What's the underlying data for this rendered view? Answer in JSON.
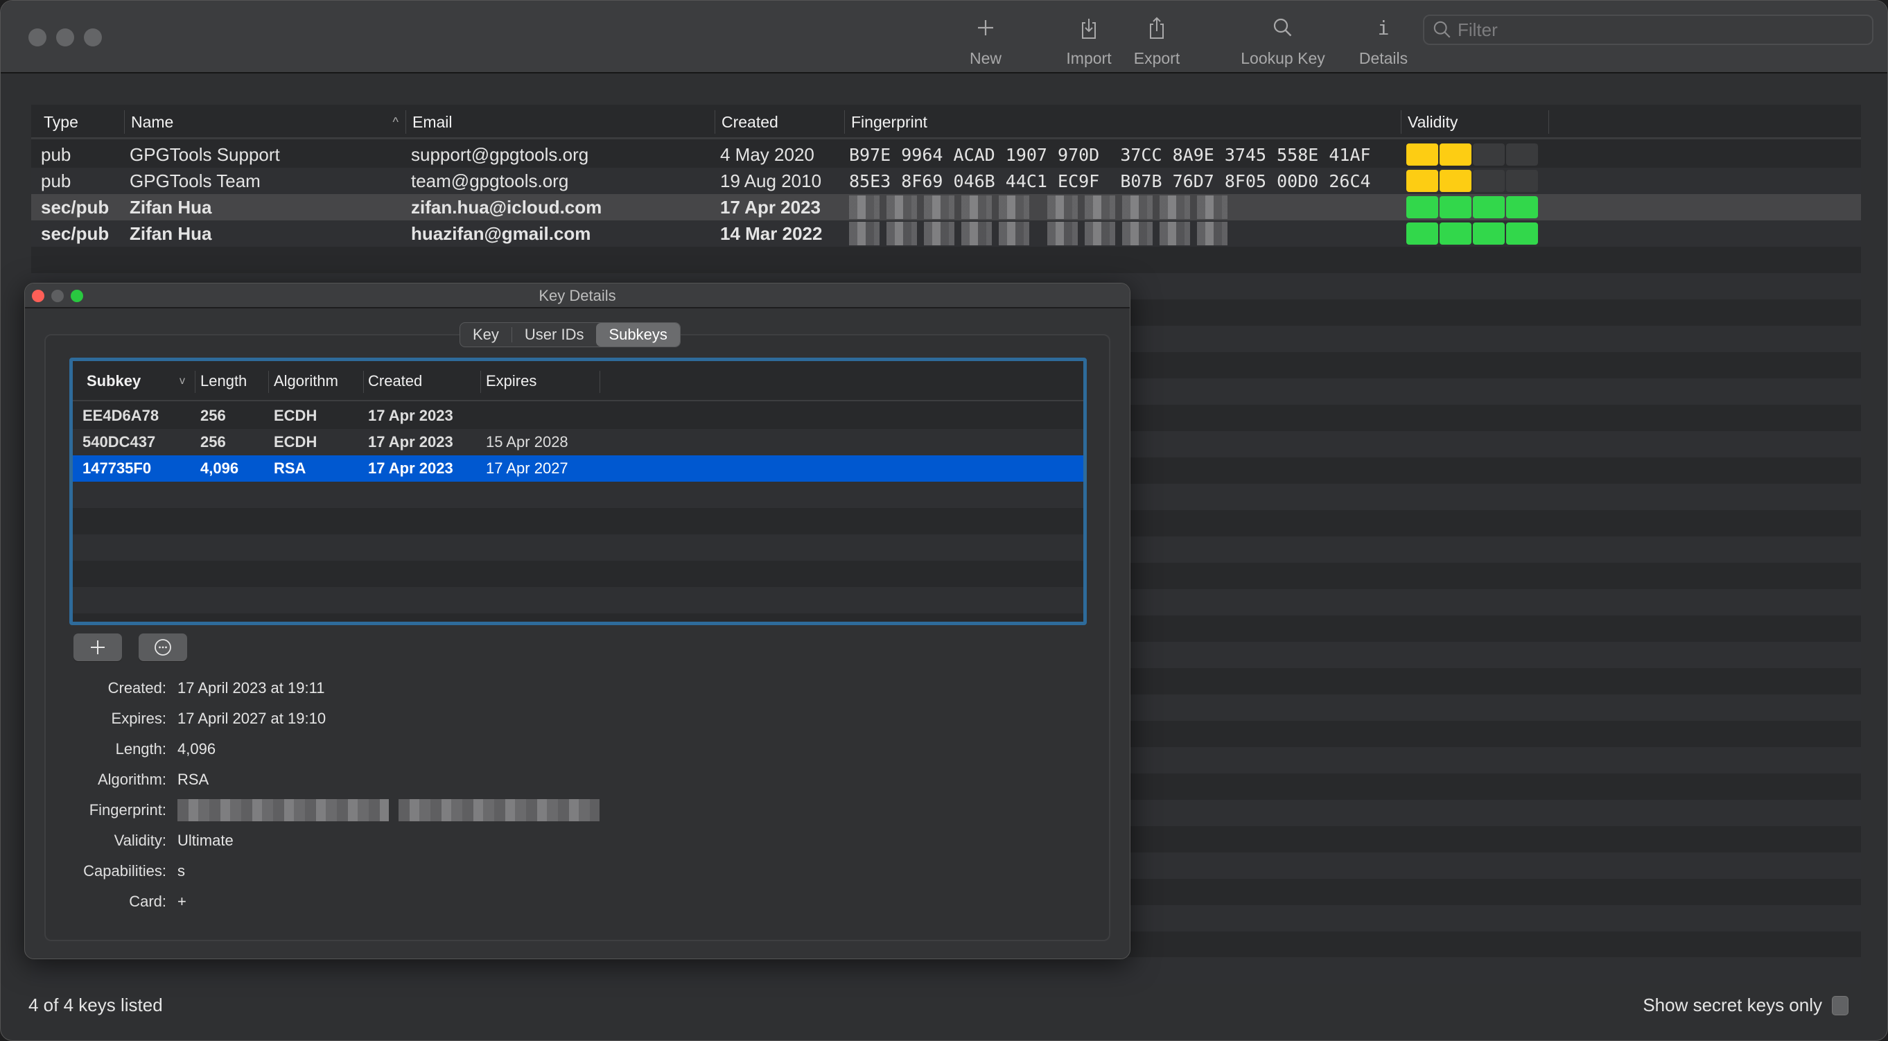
{
  "toolbar": {
    "buttons": [
      {
        "label": "New",
        "icon": "plus-icon"
      },
      {
        "label": "Import",
        "icon": "import-icon"
      },
      {
        "label": "Export",
        "icon": "export-icon"
      },
      {
        "label": "Lookup Key",
        "icon": "magnifier-icon"
      },
      {
        "label": "Details",
        "icon": "info-icon"
      }
    ],
    "filter_placeholder": "Filter",
    "filter_value": ""
  },
  "keys_table": {
    "columns": [
      "Type",
      "Name",
      "Email",
      "Created",
      "Fingerprint",
      "Validity"
    ],
    "sort_column": "Name",
    "sort_direction": "ascending",
    "rows": [
      {
        "type": "pub",
        "name": "GPGTools Support",
        "email": "support@gpgtools.org",
        "created": "4 May 2020",
        "fingerprint": "B97E 9964 ACAD 1907 970D  37CC 8A9E 3745 558E 41AF",
        "fingerprint_redacted": false,
        "validity_level": 2,
        "validity_max": 4,
        "validity_color": "#fdcd13",
        "bold": false,
        "selected": false
      },
      {
        "type": "pub",
        "name": "GPGTools Team",
        "email": "team@gpgtools.org",
        "created": "19 Aug 2010",
        "fingerprint": "85E3 8F69 046B 44C1 EC9F  B07B 76D7 8F05 00D0 26C4",
        "fingerprint_redacted": false,
        "validity_level": 2,
        "validity_max": 4,
        "validity_color": "#fdcd13",
        "bold": false,
        "selected": false
      },
      {
        "type": "sec/pub",
        "name": "Zifan Hua",
        "email": "zifan.hua@icloud.com",
        "created": "17 Apr 2023",
        "fingerprint": "",
        "fingerprint_redacted": true,
        "validity_level": 4,
        "validity_max": 4,
        "validity_color": "#32d74b",
        "bold": true,
        "selected": true
      },
      {
        "type": "sec/pub",
        "name": "Zifan Hua",
        "email": "huazifan@gmail.com",
        "created": "14 Mar 2022",
        "fingerprint": "",
        "fingerprint_redacted": true,
        "validity_level": 4,
        "validity_max": 4,
        "validity_color": "#32d74b",
        "bold": true,
        "selected": false
      }
    ]
  },
  "status": {
    "count_text": "4 of 4 keys listed",
    "secret_only_label": "Show secret keys only",
    "secret_only_checked": false
  },
  "key_details": {
    "title": "Key Details",
    "tabs": [
      {
        "label": "Key",
        "active": false
      },
      {
        "label": "User IDs",
        "active": false
      },
      {
        "label": "Subkeys",
        "active": true
      }
    ],
    "subkeys": {
      "columns": [
        "Subkey",
        "Length",
        "Algorithm",
        "Created",
        "Expires"
      ],
      "rows": [
        {
          "subkey": "EE4D6A78",
          "length": "256",
          "algorithm": "ECDH",
          "created": "17 Apr 2023",
          "expires": "",
          "selected": false
        },
        {
          "subkey": "540DC437",
          "length": "256",
          "algorithm": "ECDH",
          "created": "17 Apr 2023",
          "expires": "15 Apr 2028",
          "selected": false
        },
        {
          "subkey": "147735F0",
          "length": "4,096",
          "algorithm": "RSA",
          "created": "17 Apr 2023",
          "expires": "17 Apr 2027",
          "selected": true
        }
      ]
    },
    "add_button_icon": "plus-icon",
    "more_button_icon": "ellipsis-circle-icon",
    "fields": [
      {
        "label": "Created:",
        "value": "17 April 2023 at 19:11"
      },
      {
        "label": "Expires:",
        "value": "17 April 2027 at 19:10"
      },
      {
        "label": "Length:",
        "value": "4,096"
      },
      {
        "label": "Algorithm:",
        "value": "RSA"
      },
      {
        "label": "Fingerprint:",
        "value": "",
        "redacted": true
      },
      {
        "label": "Validity:",
        "value": "Ultimate"
      },
      {
        "label": "Capabilities:",
        "value": "s"
      },
      {
        "label": "Card:",
        "value": "+"
      }
    ]
  }
}
